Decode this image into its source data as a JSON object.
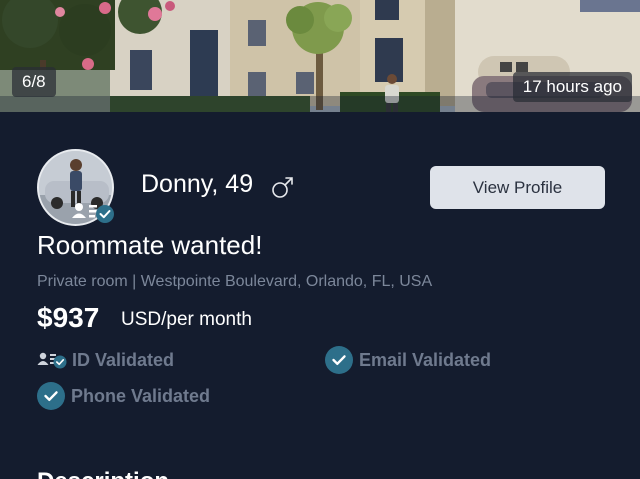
{
  "photo": {
    "counter": "6/8",
    "timestamp": "17 hours ago"
  },
  "listing": {
    "name": "Donny, 49",
    "gender_icon": "male-symbol-icon",
    "view_profile_label": "View Profile",
    "headline": "Roommate wanted!",
    "details": "Private room | Westpointe Boulevard, Orlando, FL, USA",
    "price": "$937",
    "price_unit": "USD/per month",
    "verifications": {
      "id": "ID Validated",
      "email": "Email Validated",
      "phone": "Phone Validated"
    },
    "description_title": "Description"
  },
  "colors": {
    "background": "#141c2e",
    "button_bg": "#dfe3ea",
    "check_badge": "#2d6f8a",
    "muted_text": "#7c879a"
  }
}
